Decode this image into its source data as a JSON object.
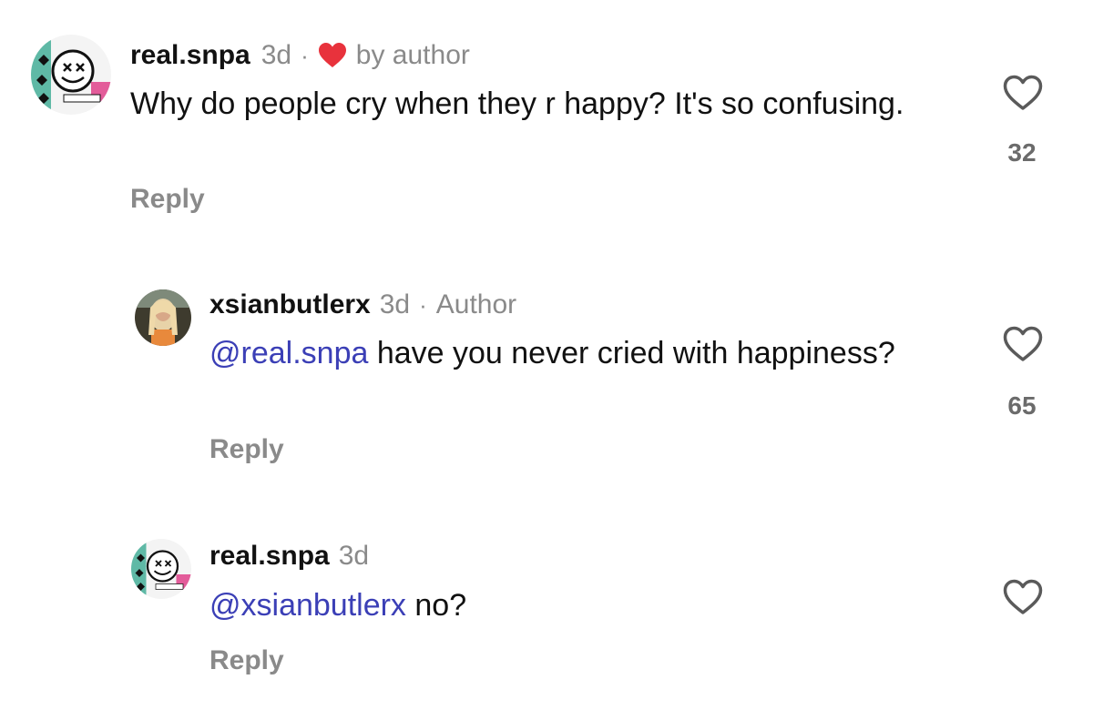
{
  "comments": [
    {
      "username": "real.snpa",
      "time": "3d",
      "liked_by_author_label": "by author",
      "text": "Why do people cry when they r happy? It's so confusing.",
      "reply_label": "Reply",
      "likes": "32",
      "avatar_icon": "blink-182-smiley-avatar"
    },
    {
      "username": "xsianbutlerx",
      "time": "3d",
      "badge": "Author",
      "mention": "@real.snpa",
      "text": " have you never cried with happiness?",
      "reply_label": "Reply",
      "likes": "65",
      "avatar_icon": "photo-avatar"
    },
    {
      "username": "real.snpa",
      "time": "3d",
      "mention": "@xsianbutlerx",
      "text": " no?",
      "reply_label": "Reply",
      "avatar_icon": "blink-182-smiley-avatar"
    }
  ],
  "colors": {
    "mention": "#3b3fb6",
    "muted": "#8a8a8a",
    "heart_red": "#e8323c"
  }
}
